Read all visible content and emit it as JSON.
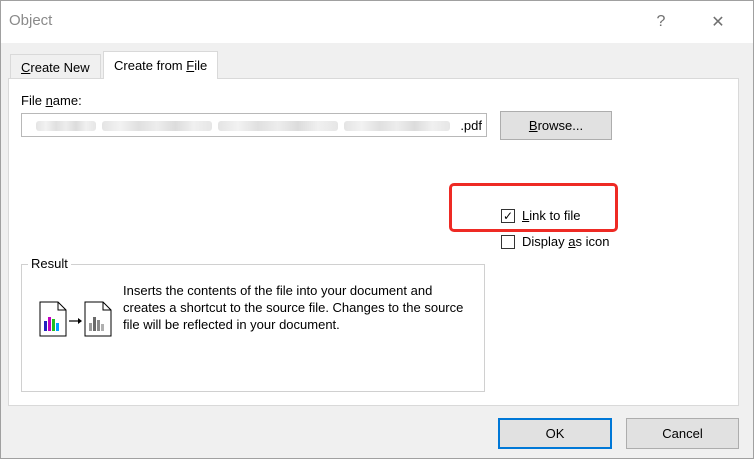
{
  "window": {
    "title": "Object",
    "help_glyph": "?",
    "close_glyph": "✕"
  },
  "tabs": [
    {
      "label": "Create New",
      "accel": "C",
      "rest": "reate New"
    },
    {
      "label": "Create from File",
      "pre": "Create from ",
      "accel": "F",
      "rest": "ile"
    }
  ],
  "file": {
    "label_pre": "File ",
    "label_accel": "n",
    "label_rest": "ame:",
    "value_visible": ".pdf",
    "browse_accel": "B",
    "browse_rest": "rowse..."
  },
  "options": {
    "link_to_file": {
      "pre": "",
      "accel": "L",
      "rest": "ink to file",
      "checked": true,
      "check_glyph": "✓"
    },
    "display_as_icon": {
      "pre": "Display ",
      "accel": "a",
      "rest": "s icon",
      "checked": false
    }
  },
  "result": {
    "legend": "Result",
    "text": "Inserts the contents of the file into your document and creates a shortcut to the source file.  Changes to the source file will be reflected in your document."
  },
  "buttons": {
    "ok": "OK",
    "cancel": "Cancel"
  },
  "colors": {
    "highlight": "#ee2a24",
    "default_button_border": "#0078d7"
  }
}
